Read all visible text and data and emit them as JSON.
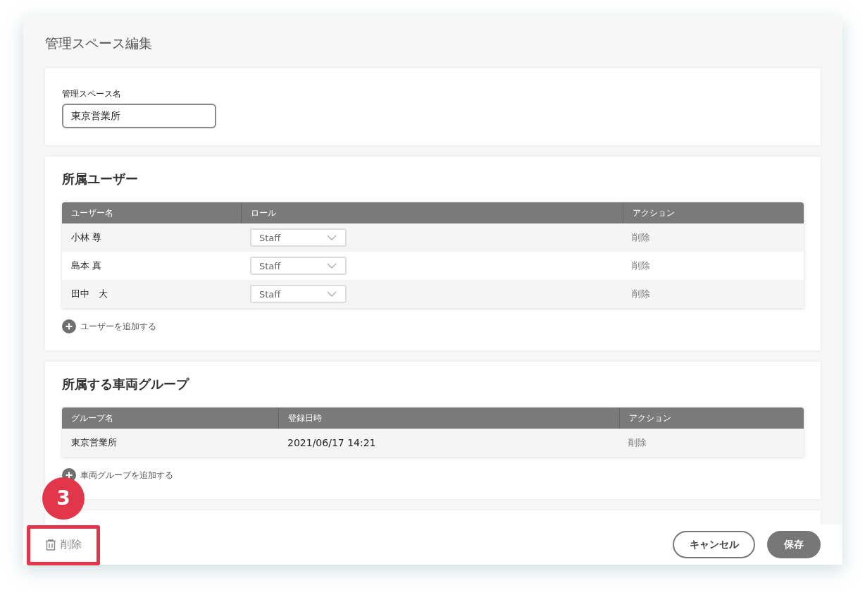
{
  "dialog": {
    "title": "管理スペース編集"
  },
  "name_section": {
    "label": "管理スペース名",
    "value": "東京営業所"
  },
  "users_section": {
    "title": "所属ユーザー",
    "columns": [
      "ユーザー名",
      "ロール",
      "アクション"
    ],
    "rows": [
      {
        "name": "小林 尊",
        "role": "Staff",
        "action": "削除"
      },
      {
        "name": "島本 真",
        "role": "Staff",
        "action": "削除"
      },
      {
        "name": "田中　大",
        "role": "Staff",
        "action": "削除"
      }
    ],
    "add_link": "ユーザーを追加する"
  },
  "groups_section": {
    "title": "所属する車両グループ",
    "columns": [
      "グループ名",
      "登録日時",
      "アクション"
    ],
    "rows": [
      {
        "name": "東京営業所",
        "registered": "2021/06/17 14:21",
        "action": "削除"
      }
    ],
    "add_link": "車両グループを追加する"
  },
  "footer": {
    "delete_button": "削除",
    "cancel_button": "キャンセル",
    "save_button": "保存"
  },
  "annotation": {
    "number": "3"
  }
}
